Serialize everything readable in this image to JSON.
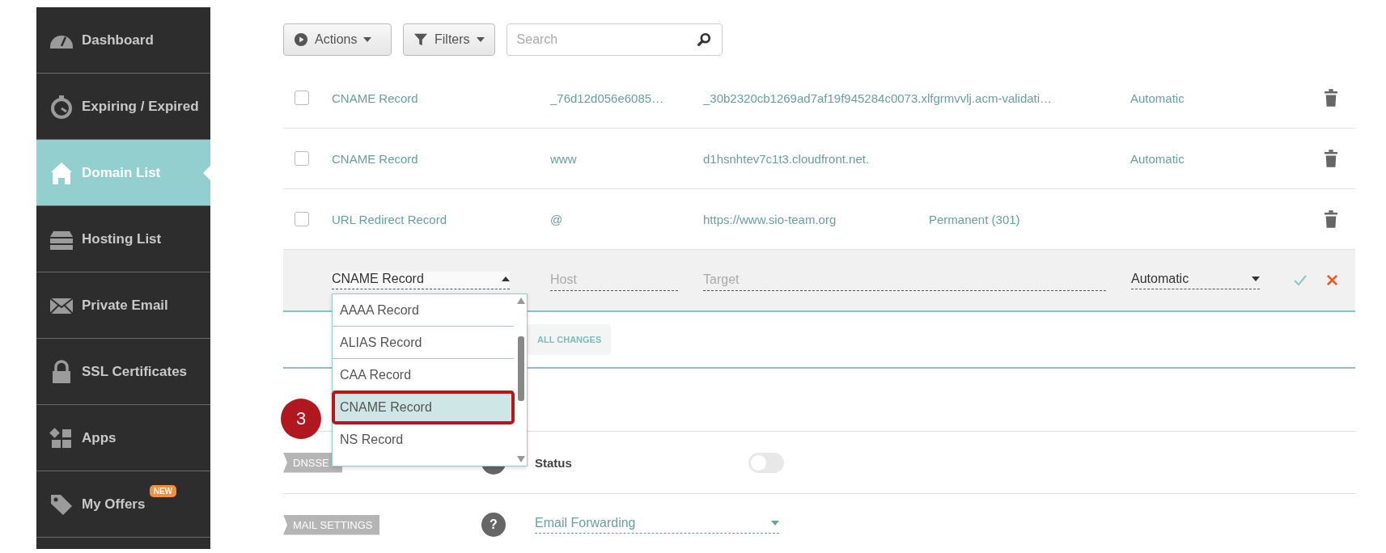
{
  "sidebar": {
    "items": [
      {
        "kind": "gauge",
        "label": "Dashboard",
        "selected": false
      },
      {
        "kind": "timer",
        "label": "Expiring / Expired",
        "selected": false
      },
      {
        "kind": "house",
        "label": "Domain List",
        "selected": true
      },
      {
        "kind": "server",
        "label": "Hosting List",
        "selected": false
      },
      {
        "kind": "envelope",
        "label": "Private Email",
        "selected": false
      },
      {
        "kind": "lock",
        "label": "SSL Certificates",
        "selected": false
      },
      {
        "kind": "apps",
        "label": "Apps",
        "selected": false
      },
      {
        "kind": "tag",
        "label": "My Offers",
        "selected": false,
        "badge": "NEW"
      }
    ]
  },
  "toolbar": {
    "actions": "Actions",
    "filters": "Filters",
    "search": {
      "placeholder": "Search"
    }
  },
  "records": [
    {
      "type": "CNAME Record",
      "host": "_76d12d056e6085…",
      "value": "_30b2320cb1269ad7af19f945284c0073.xlfgrmvvlj.acm-validati…",
      "ttl": "Automatic",
      "checked": false
    },
    {
      "type": "CNAME Record",
      "host": "www",
      "value": "d1hsnhtev7c1t3.cloudfront.net.",
      "ttl": "Automatic",
      "checked": false
    },
    {
      "type": "URL Redirect Record",
      "host": "@",
      "value": "https://www.sio-team.org",
      "extra": "Permanent (301)",
      "checked": false
    }
  ],
  "new_record": {
    "type": "CNAME Record",
    "host": {
      "placeholder": "Host"
    },
    "target": {
      "placeholder": "Target"
    },
    "ttl": "Automatic",
    "options": [
      {
        "label": "AAAA Record",
        "selected": false
      },
      {
        "label": "ALIAS Record",
        "selected": false
      },
      {
        "label": "CAA Record",
        "selected": false
      },
      {
        "label": "CNAME Record",
        "selected": true
      },
      {
        "label": "NS Record",
        "selected": false
      }
    ]
  },
  "save_button": "ALL CHANGES",
  "step_marker": "3",
  "dnssec": {
    "tag": "DNSSE",
    "status_label": "Status",
    "on": false
  },
  "mail_settings": {
    "tag": "MAIL SETTINGS",
    "help": "?",
    "value": "Email Forwarding"
  }
}
